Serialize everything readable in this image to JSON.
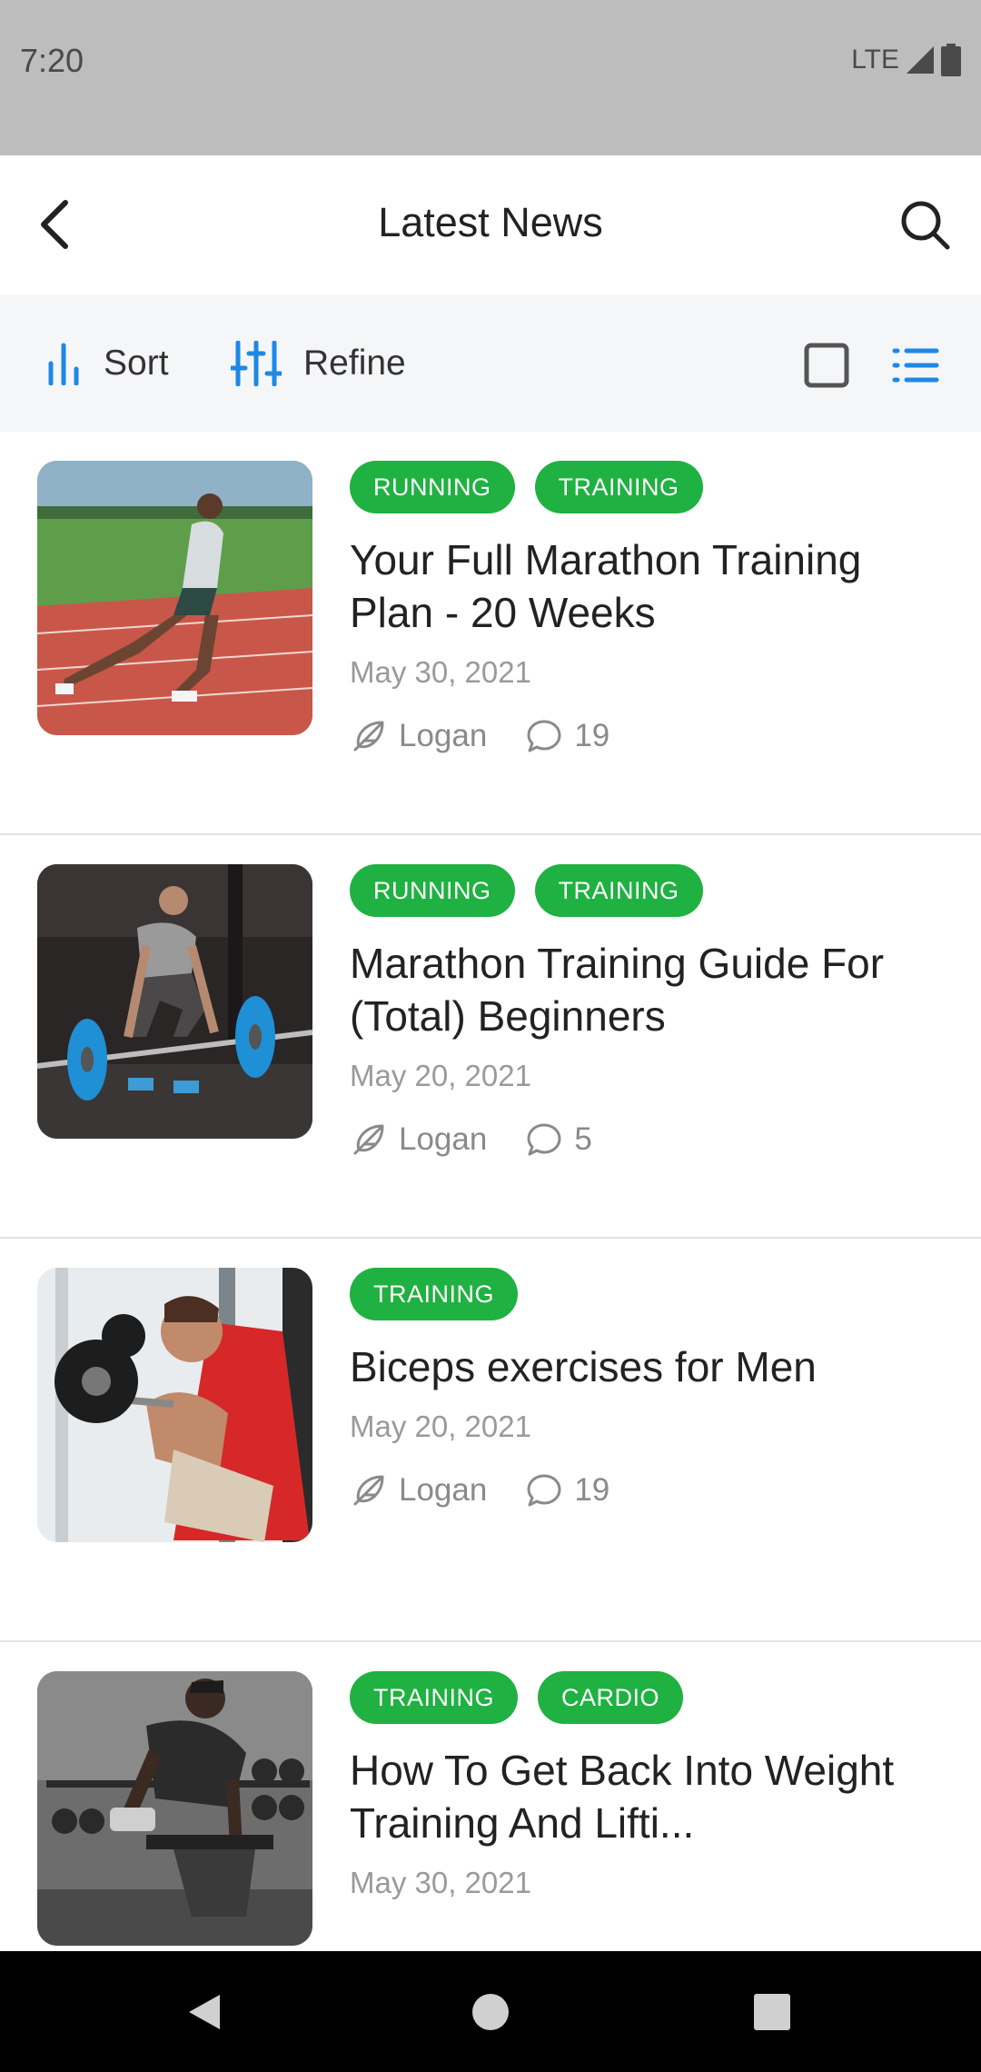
{
  "status_bar": {
    "time": "7:20",
    "network": "LTE"
  },
  "app_bar": {
    "title": "Latest News",
    "back_icon": "back-arrow-icon",
    "search_icon": "search-icon"
  },
  "toolbar": {
    "sort_label": "Sort",
    "refine_label": "Refine",
    "grid_view_icon": "grid-view-icon",
    "list_view_icon": "list-view-icon",
    "active_view": "list"
  },
  "colors": {
    "accent": "#1fb141",
    "link_blue": "#1e88e5"
  },
  "articles": [
    {
      "tags": [
        "RUNNING",
        "TRAINING"
      ],
      "title": "Your Full Marathon Training Plan - 20 Weeks",
      "date": "May 30, 2021",
      "author": "Logan",
      "comments": "19"
    },
    {
      "tags": [
        "RUNNING",
        "TRAINING"
      ],
      "title": "Marathon Training Guide For (Total) Beginners",
      "date": "May 20, 2021",
      "author": "Logan",
      "comments": "5"
    },
    {
      "tags": [
        "TRAINING"
      ],
      "title": "Biceps exercises for Men",
      "date": "May 20, 2021",
      "author": "Logan",
      "comments": "19"
    },
    {
      "tags": [
        "TRAINING",
        "CARDIO"
      ],
      "title": "How To Get Back Into Weight Training And Lifti...",
      "date": "May 30, 2021",
      "author": "",
      "comments": ""
    }
  ]
}
